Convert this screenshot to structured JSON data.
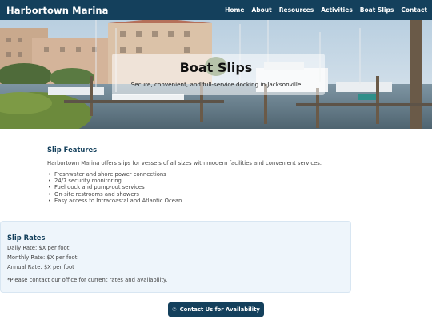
{
  "header": {
    "brand": "Harbortown Marina",
    "nav": [
      "Home",
      "About",
      "Resources",
      "Activities",
      "Boat Slips",
      "Contact"
    ]
  },
  "hero": {
    "title": "Boat Slips",
    "subtitle": "Secure, convenient, and full-service docking in Jacksonville"
  },
  "features": {
    "title": "Slip Features",
    "intro": "Harbortown Marina offers slips for vessels of all sizes with modern facilities and convenient services:",
    "items": [
      "Freshwater and shore power connections",
      "24/7 security monitoring",
      "Fuel dock and pump-out services",
      "On-site restrooms and showers",
      "Easy access to Intracoastal and Atlantic Ocean"
    ]
  },
  "rates": {
    "title": "Slip Rates",
    "lines": [
      "Daily Rate: $X per foot",
      "Monthly Rate: $X per foot",
      "Annual Rate: $X per foot"
    ],
    "note": "*Please contact our office for current rates and availability."
  },
  "cta": {
    "icon": "phone-icon",
    "label": "Contact Us for Availability"
  },
  "colors": {
    "brand": "#14405c",
    "rates_bg": "#eef5fb"
  }
}
